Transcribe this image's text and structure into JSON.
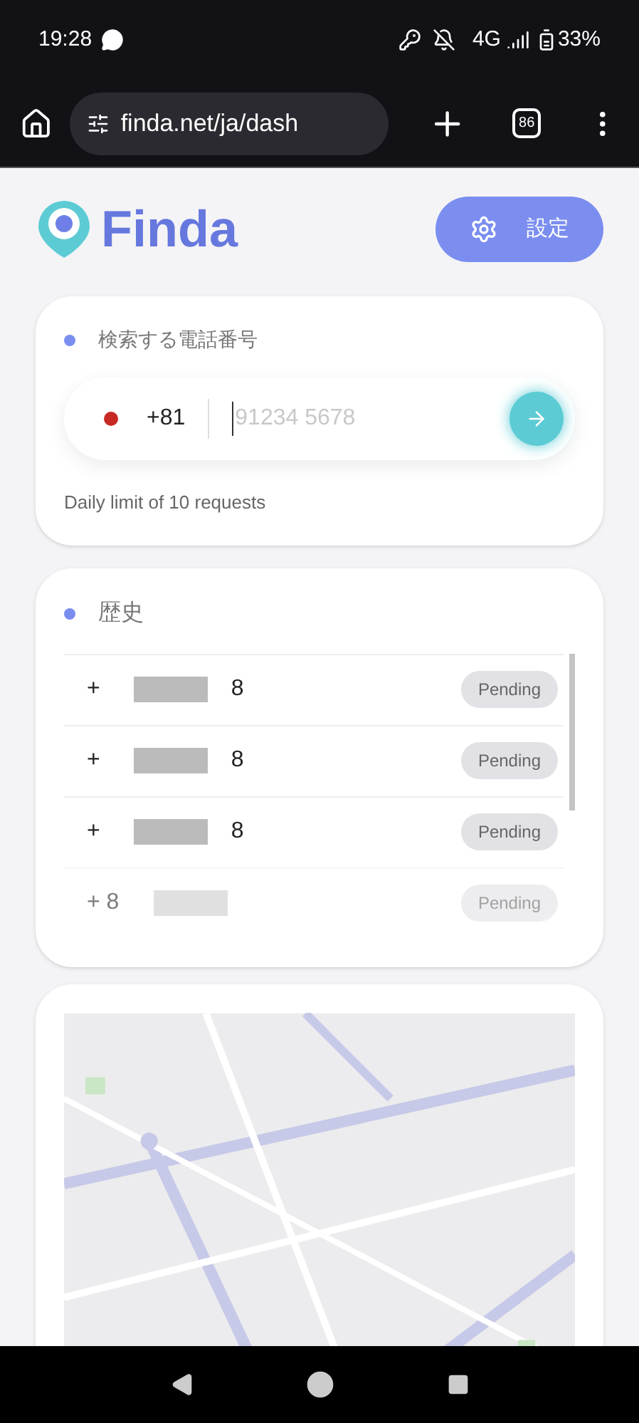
{
  "status_bar": {
    "time": "19:28",
    "network": "4G",
    "battery": "33%"
  },
  "browser": {
    "url": "finda.net/ja/dash",
    "tab_count": "86"
  },
  "header": {
    "logo": "Finda",
    "settings_button": "設定"
  },
  "search_card": {
    "title": "検索する電話番号",
    "country_code": "+81",
    "placeholder": "91234 5678",
    "note": "Daily limit of 10 requests"
  },
  "history": {
    "title": "歴史",
    "rows": [
      {
        "number_start": "+",
        "number_end": "8",
        "status": "Pending",
        "faded": false
      },
      {
        "number_start": "+",
        "number_end": "8",
        "status": "Pending",
        "faded": false
      },
      {
        "number_start": "+",
        "number_end": "8",
        "status": "Pending",
        "faded": false
      },
      {
        "number_start": "+ 8",
        "number_end": "",
        "status": "Pending",
        "faded": true
      }
    ]
  }
}
